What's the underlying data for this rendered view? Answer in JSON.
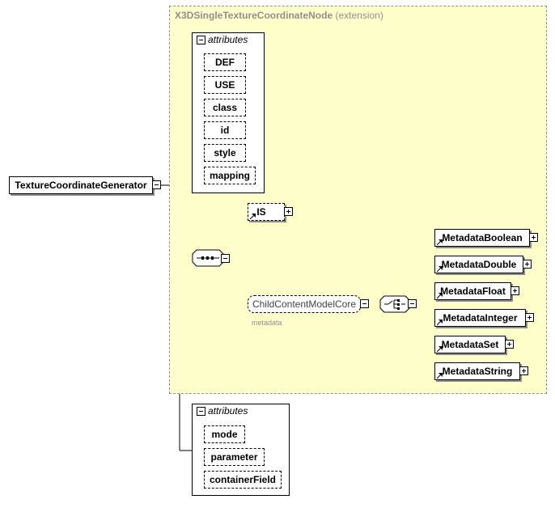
{
  "extension": {
    "name": "X3DSingleTextureCoordinateNode",
    "suffix": "(extension)",
    "attributes_label": "attributes",
    "attributes": [
      "DEF",
      "USE",
      "class",
      "id",
      "style",
      "mapping"
    ],
    "is_element": "IS",
    "group_name": "ChildContentModelCore",
    "group_sublabel": "metadata",
    "metadata_elements": [
      "MetadataBoolean",
      "MetadataDouble",
      "MetadataFloat",
      "MetadataInteger",
      "MetadataSet",
      "MetadataString"
    ]
  },
  "root_element": "TextureCoordinateGenerator",
  "own_attributes": {
    "label": "attributes",
    "items": [
      "mode",
      "parameter",
      "containerField"
    ]
  },
  "colors": {
    "extension_bg": "#ffffcc",
    "extension_border": "#8f8f8f"
  }
}
